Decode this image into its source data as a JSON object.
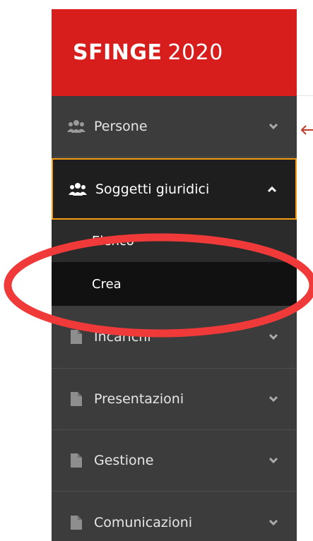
{
  "brand": {
    "name": "SFINGE",
    "year": "2020",
    "color": "#d81d1d"
  },
  "nav": {
    "items": [
      {
        "label": "Persone",
        "icon": "users-icon",
        "state": "collapsed"
      },
      {
        "label": "Soggetti giuridici",
        "icon": "users-icon",
        "state": "expanded"
      },
      {
        "label": "Incarichi",
        "icon": "file-icon",
        "state": "collapsed"
      },
      {
        "label": "Presentazioni",
        "icon": "file-icon",
        "state": "collapsed"
      },
      {
        "label": "Gestione",
        "icon": "file-icon",
        "state": "collapsed"
      },
      {
        "label": "Comunicazioni",
        "icon": "file-icon",
        "state": "collapsed"
      }
    ],
    "submenu": [
      {
        "label": "Elenco"
      },
      {
        "label": "Crea"
      }
    ]
  },
  "colors": {
    "sidebar": "#3c3c3c",
    "active_border": "#f39c12",
    "highlight_ellipse": "#f03a3a"
  }
}
